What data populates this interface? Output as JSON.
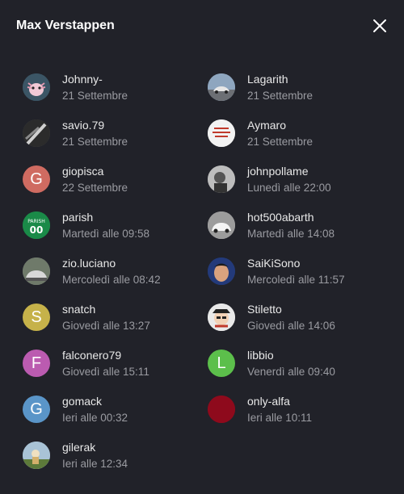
{
  "dialog": {
    "title": "Max Verstappen"
  },
  "users": [
    {
      "name": "Johnny-",
      "time": "21 Settembre",
      "avatar": "axolotl-avatar",
      "color": "#3b5565"
    },
    {
      "name": "Lagarith",
      "time": "21 Settembre",
      "avatar": "car-avatar",
      "color": "#8ea6bf"
    },
    {
      "name": "savio.79",
      "time": "21 Settembre",
      "avatar": "dark-photo-avatar",
      "color": "#555555"
    },
    {
      "name": "Aymaro",
      "time": "21 Settembre",
      "avatar": "text-logo-avatar",
      "color": "#f2f2f2"
    },
    {
      "name": "giopisca",
      "time": "22 Settembre",
      "avatar": "letter",
      "letter": "G",
      "color": "#cf6b61"
    },
    {
      "name": "johnpollame",
      "time": "Lunedì alle 22:00",
      "avatar": "bw-photo-avatar",
      "color": "#9a9a9a"
    },
    {
      "name": "parish",
      "time": "Martedì alle 09:58",
      "avatar": "jersey-avatar",
      "color": "#1a8a48"
    },
    {
      "name": "hot500abarth",
      "time": "Martedì alle 14:08",
      "avatar": "white-car-avatar",
      "color": "#cfcfcf"
    },
    {
      "name": "zio.luciano",
      "time": "Mercoledì alle 08:42",
      "avatar": "silver-car-avatar",
      "color": "#8c8c8c"
    },
    {
      "name": "SaiKiSono",
      "time": "Mercoledì alle 11:57",
      "avatar": "face-avatar",
      "color": "#233a7a"
    },
    {
      "name": "snatch",
      "time": "Giovedì alle 13:27",
      "avatar": "letter",
      "letter": "S",
      "color": "#c6b24a"
    },
    {
      "name": "Stiletto",
      "time": "Giovedì alle 14:06",
      "avatar": "cartoon-avatar",
      "color": "#e9e9e9"
    },
    {
      "name": "falconero79",
      "time": "Giovedì alle 15:11",
      "avatar": "letter",
      "letter": "F",
      "color": "#bb5bb0"
    },
    {
      "name": "libbio",
      "time": "Venerdì alle 09:40",
      "avatar": "letter",
      "letter": "L",
      "color": "#5cbf4b"
    },
    {
      "name": "gomack",
      "time": "Ieri alle 00:32",
      "avatar": "letter",
      "letter": "G",
      "color": "#5a95c8"
    },
    {
      "name": "only-alfa",
      "time": "Ieri alle 10:11",
      "avatar": "solid-avatar",
      "color": "#8e0a1c"
    },
    {
      "name": "gilerak",
      "time": "Ieri alle 12:34",
      "avatar": "scene-avatar",
      "color": "#a9c3d6"
    }
  ]
}
